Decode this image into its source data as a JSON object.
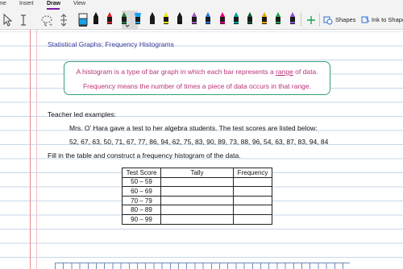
{
  "ribbon": {
    "tabs": [
      "me",
      "Insert",
      "Draw",
      "View"
    ],
    "active_tab": "Draw"
  },
  "toolbar": {
    "pen_colors": [
      "#111111",
      "#e02020",
      "#1f7a3a",
      "#1da1f2",
      "#1a1a1a",
      "#f5e100",
      "#111111",
      "#9b59b6",
      "#2c6fdb",
      "#e6007e",
      "#00a0a0",
      "#0b5d2a",
      "#e8a000",
      "#1aa34a",
      "#8a4fd8"
    ],
    "shapes_label": "Shapes",
    "ink_to_shape_label": "Ink to Shape",
    "accent": "#7719aa"
  },
  "page": {
    "title": "Statistical Graphs:  Frequency Histograms",
    "definition_line1_pre": "A histogram is a type of bar graph in which each bar represents a ",
    "definition_line1_link": "range",
    "definition_line1_post": " of data.",
    "definition_line2": "Frequency means the number of times a piece of data occurs in that range.",
    "teacher_led": "Teacher led examples:",
    "problem": "Mrs. O’ Hara gave a test to her algebra students.  The test scores are listed below:",
    "scores": "52, 67, 63, 50, 71, 67, 77, 86, 94, 62, 75, 83, 90, 89, 73, 88, 96, 54, 63, 87, 83, 94, 84",
    "instruction": "Fill in the table and construct a frequency histogram of the data.",
    "table": {
      "headers": [
        "Test Score",
        "Tally",
        "Frequency"
      ],
      "rows": [
        [
          "50 – 59",
          "",
          ""
        ],
        [
          "60 – 69",
          "",
          ""
        ],
        [
          "70 – 79",
          "",
          ""
        ],
        [
          "80 – 89",
          "",
          ""
        ],
        [
          "90 – 99",
          "",
          ""
        ]
      ]
    }
  }
}
